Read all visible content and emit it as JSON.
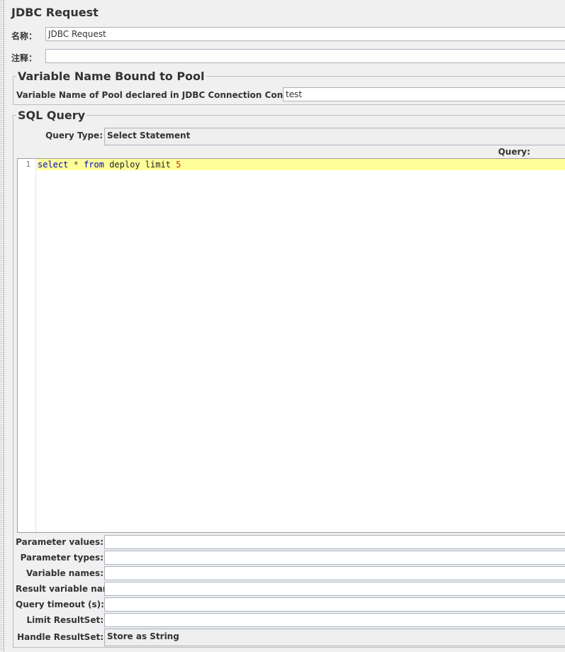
{
  "panel": {
    "title": "JDBC Request"
  },
  "name_row": {
    "label": "名称：",
    "value": "JDBC Request"
  },
  "comment_row": {
    "label": "注释：",
    "value": ""
  },
  "pool_section": {
    "legend": "Variable Name Bound to Pool",
    "label": "Variable Name of Pool declared in JDBC Connection Configuration:",
    "value": "test"
  },
  "sql_section": {
    "legend": "SQL Query",
    "query_type_label": "Query Type:",
    "query_type_value": "Select Statement",
    "query_label": "Query:",
    "editor": {
      "line_number": "1",
      "tokens": {
        "kw1": "select",
        "op": "*",
        "kw2": "from",
        "ident": "deploy limit",
        "num": "5"
      }
    }
  },
  "fields": {
    "parameter_values": {
      "label": "Parameter values:",
      "value": ""
    },
    "parameter_types": {
      "label": "Parameter types:",
      "value": ""
    },
    "variable_names": {
      "label": "Variable names:",
      "value": ""
    },
    "result_variable_name": {
      "label": "Result variable name:",
      "value": ""
    },
    "query_timeout": {
      "label": "Query timeout (s):",
      "value": ""
    },
    "limit_resultset": {
      "label": "Limit ResultSet:",
      "value": ""
    },
    "handle_resultset": {
      "label": "Handle ResultSet:",
      "value": "Store as String"
    }
  },
  "colors": {
    "background": "#f0f0f0",
    "current_line_highlight": "#ffff99",
    "sql_keyword": "#0000cc",
    "sql_number": "#cc3300"
  }
}
